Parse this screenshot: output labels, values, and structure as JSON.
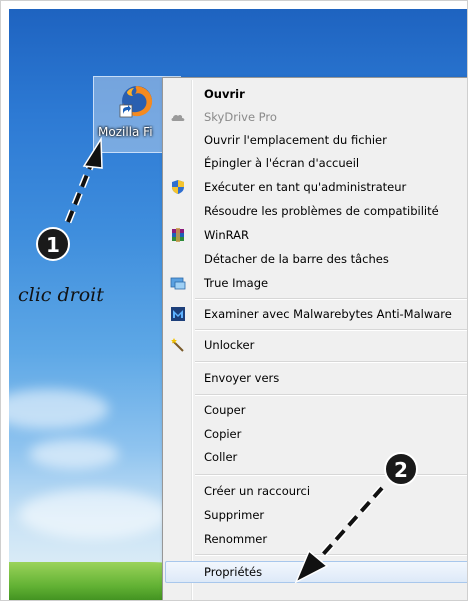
{
  "desktop": {
    "shortcut_label": "Mozilla Fi",
    "shortcut_icon": "firefox-icon"
  },
  "annotation": {
    "step1": "1",
    "step2": "2",
    "caption": "clic droit"
  },
  "context_menu": {
    "items": [
      {
        "label": "Ouvrir",
        "icon": "",
        "state": "bold"
      },
      {
        "label": "SkyDrive Pro",
        "icon": "skydrive-icon",
        "state": "disabled"
      },
      {
        "label": "Ouvrir l'emplacement du fichier",
        "icon": "",
        "state": "normal"
      },
      {
        "label": "Épingler à l'écran d'accueil",
        "icon": "",
        "state": "normal"
      },
      {
        "label": "Exécuter en tant qu'administrateur",
        "icon": "uac-shield-icon",
        "state": "normal"
      },
      {
        "label": "Résoudre les problèmes de compatibilité",
        "icon": "",
        "state": "normal"
      },
      {
        "label": "WinRAR",
        "icon": "winrar-icon",
        "state": "normal"
      },
      {
        "label": "Détacher de la barre des tâches",
        "icon": "",
        "state": "normal"
      },
      {
        "label": "True Image",
        "icon": "true-image-icon",
        "state": "normal"
      },
      {
        "label": "Examiner avec Malwarebytes Anti-Malware",
        "icon": "malwarebytes-icon",
        "state": "normal"
      },
      {
        "label": "Unlocker",
        "icon": "unlocker-wand-icon",
        "state": "normal"
      },
      {
        "label": "Envoyer vers",
        "icon": "",
        "state": "normal"
      },
      {
        "label": "Couper",
        "icon": "",
        "state": "normal"
      },
      {
        "label": "Copier",
        "icon": "",
        "state": "normal"
      },
      {
        "label": "Coller",
        "icon": "",
        "state": "normal"
      },
      {
        "label": "Créer un raccourci",
        "icon": "",
        "state": "normal"
      },
      {
        "label": "Supprimer",
        "icon": "",
        "state": "normal"
      },
      {
        "label": "Renommer",
        "icon": "",
        "state": "normal"
      },
      {
        "label": "Propriétés",
        "icon": "",
        "state": "highlighted"
      }
    ]
  }
}
